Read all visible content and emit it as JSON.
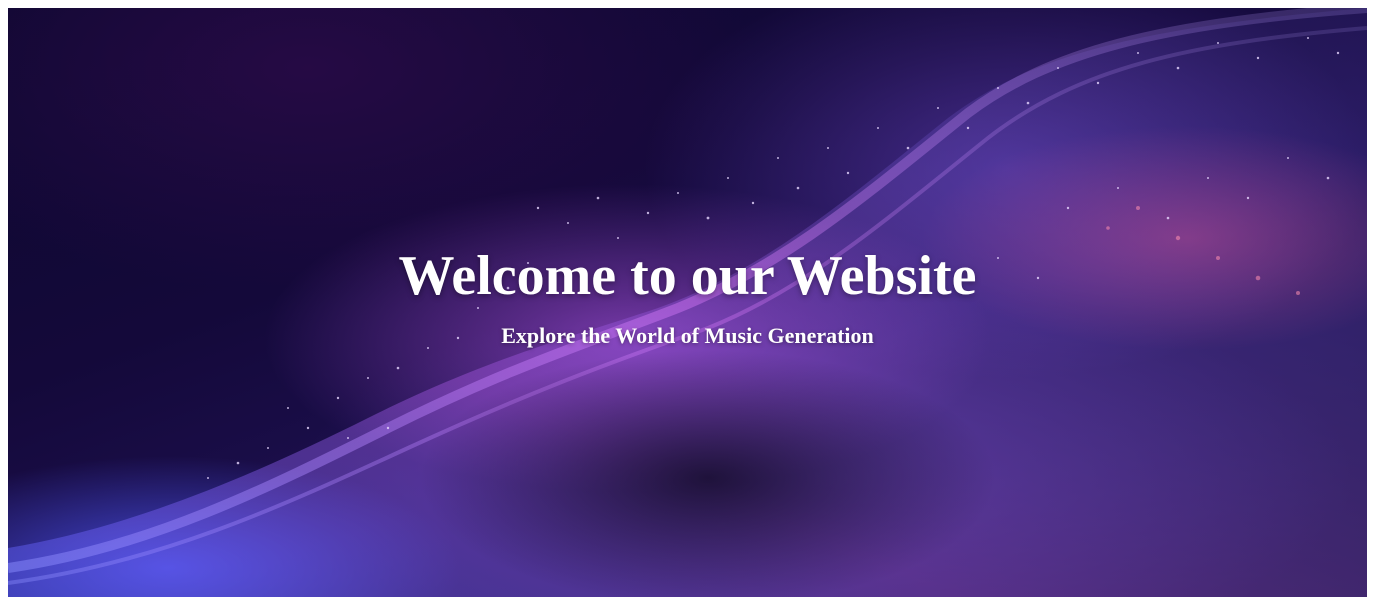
{
  "hero": {
    "title": "Welcome to our Website",
    "subtitle": "Explore the World of Music Generation",
    "background_image": "purple-blue-particle-wave"
  },
  "colors": {
    "text": "#ffffff",
    "background_dark": "#0d0830",
    "accent_purple": "#be5af0",
    "accent_blue": "#505aff",
    "accent_pink": "#d24678"
  }
}
